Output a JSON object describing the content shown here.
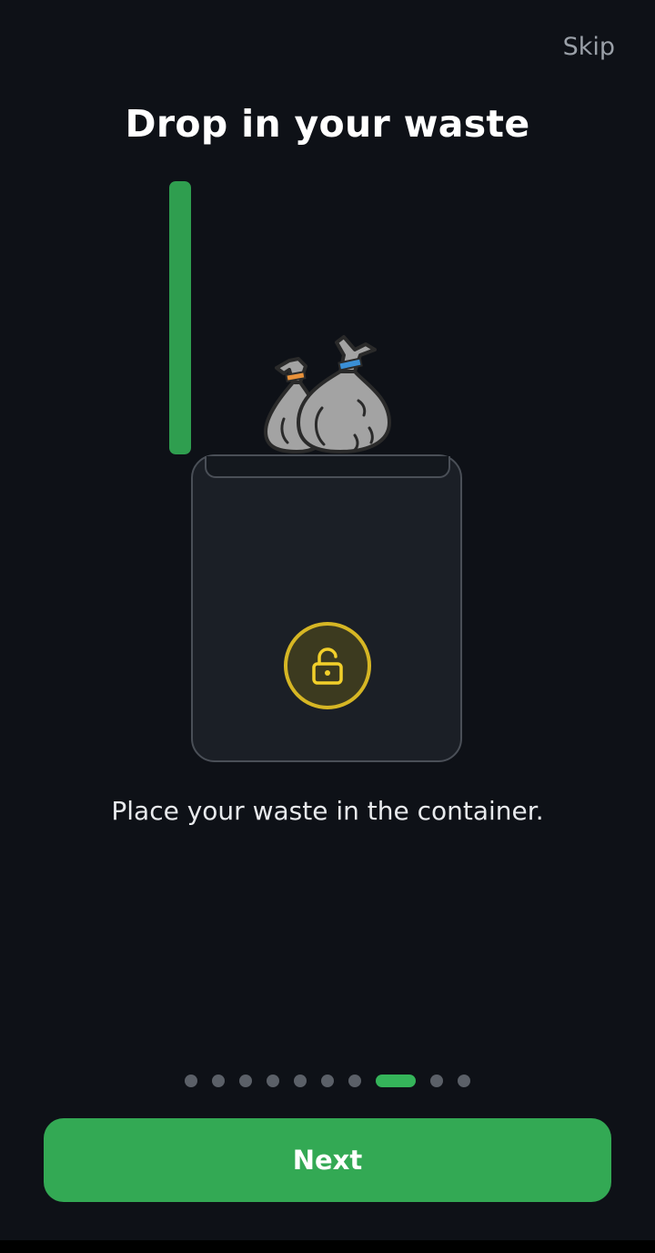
{
  "header": {
    "skip_label": "Skip",
    "title": "Drop in your waste"
  },
  "illustration": {
    "fill_level_fraction": 1.0,
    "fill_color": "#2f9e4f",
    "lock_color": "#d6b624",
    "bag_tie_colors": [
      "#e8913a",
      "#3a8fd6"
    ]
  },
  "main": {
    "instruction": "Place your waste in the container."
  },
  "pager": {
    "total_pages": 10,
    "active_index": 7
  },
  "footer": {
    "next_label": "Next",
    "button_color": "#33a954"
  }
}
